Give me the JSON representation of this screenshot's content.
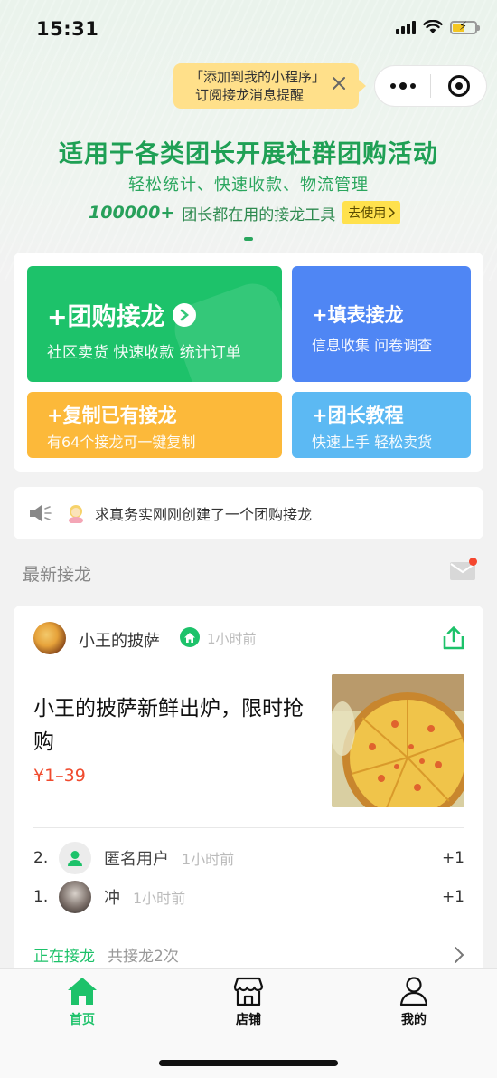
{
  "status_bar": {
    "time": "15:31"
  },
  "tooltip": {
    "line1": "「添加到我的小程序」",
    "line2": "订阅接龙消息提醒"
  },
  "hero": {
    "title": "适用于各类团长开展社群团购活动",
    "subtitle": "轻松统计、快速收款、物流管理",
    "count": "100000+",
    "count_text": "团长都在用的接龙工具",
    "go_button": "去使用"
  },
  "tiles": {
    "group_buy": {
      "title": "+团购接龙",
      "desc": "社区卖货 快速收款 统计订单"
    },
    "form": {
      "title": "+填表接龙",
      "desc": "信息收集 问卷调查"
    },
    "copy": {
      "title": "+复制已有接龙",
      "desc": "有64个接龙可一键复制"
    },
    "tutorial": {
      "title": "+团长教程",
      "desc": "快速上手 轻松卖货"
    }
  },
  "notice": {
    "text": "求真务实刚刚创建了一个团购接龙"
  },
  "latest": {
    "heading": "最新接龙"
  },
  "post": {
    "shop_name": "小王的披萨",
    "shop_time": "1小时前",
    "title": "小王的披萨新鲜出炉，限时抢购",
    "price": "¥1–39",
    "entries": [
      {
        "index": "2.",
        "name": "匿名用户",
        "time": "1小时前",
        "qty": "+1"
      },
      {
        "index": "1.",
        "name": "冲",
        "time": "1小时前",
        "qty": "+1"
      }
    ],
    "status": "正在接龙",
    "total": "共接龙2次"
  },
  "tabbar": {
    "home": "首页",
    "shop": "店铺",
    "me": "我的"
  },
  "colors": {
    "brand_green": "#1dc26a",
    "blue": "#4f86f4",
    "orange": "#fcb93a",
    "light_blue": "#5cb9f3",
    "price_red": "#f04b2e"
  }
}
